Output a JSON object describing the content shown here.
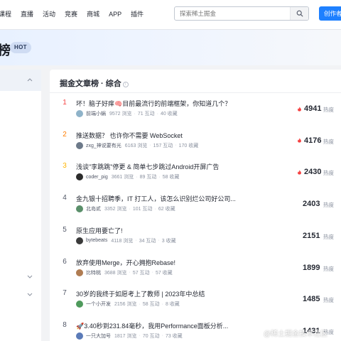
{
  "nav": {
    "items": [
      "课程",
      "直播",
      "活动",
      "竞赛",
      "商城",
      "APP",
      "插件"
    ]
  },
  "search": {
    "placeholder": "探索稀土掘金"
  },
  "creator_button": "创作者中心",
  "hero": {
    "title": "榜",
    "badge": "HOT"
  },
  "panel": {
    "title": "掘金文章榜 · 综合",
    "info_icon": "i"
  },
  "colors": {
    "accent": "#1e80ff",
    "rank1": "#f53f3f",
    "rank2": "#ff7d00",
    "rank3": "#ffb400"
  },
  "articles": [
    {
      "rank": "1",
      "title": "坏！脑子好痒🧠目前最流行的前端框架，你知道几个？",
      "author": "前端小蜗",
      "views": "9572 浏览",
      "interactions": "71 互动",
      "saves": "40 收藏",
      "score": "4941",
      "heat_label": "热度",
      "flame": true,
      "avatar_color": "#8fb3c9"
    },
    {
      "rank": "2",
      "title": "推送数据？ 也许你不需要 WebSocket",
      "author": "zxg_神说要有光",
      "views": "6163 浏览",
      "interactions": "157 互动",
      "saves": "170 收藏",
      "score": "4176",
      "heat_label": "热度",
      "flame": true,
      "avatar_color": "#6d7a8a"
    },
    {
      "rank": "3",
      "title": "浅谈\"李跳跳\"停更 & 简单七步跳过Android开屏广告",
      "author": "coder_pig",
      "views": "3661 浏览",
      "interactions": "89 互动",
      "saves": "58 收藏",
      "score": "2430",
      "heat_label": "热度",
      "flame": true,
      "avatar_color": "#2c2c2c"
    },
    {
      "rank": "4",
      "title": "金九银十招聘季，IT 打工人，该怎么识别烂公司好公司...",
      "author": "北岛贰",
      "views": "3352 浏览",
      "interactions": "101 互动",
      "saves": "62 收藏",
      "score": "2403",
      "heat_label": "热度",
      "flame": false,
      "avatar_color": "#5a8f6a"
    },
    {
      "rank": "5",
      "title": "原生应用要亡了!",
      "author": "bytebeats",
      "views": "4118 浏览",
      "interactions": "34 互动",
      "saves": "3 收藏",
      "score": "2151",
      "heat_label": "热度",
      "flame": false,
      "avatar_color": "#3a3a3a"
    },
    {
      "rank": "6",
      "title": "放弃使用Merge，开心拥抱Rebase!",
      "author": "比特桃",
      "views": "3688 浏览",
      "interactions": "57 互动",
      "saves": "57 收藏",
      "score": "1899",
      "heat_label": "热度",
      "flame": false,
      "avatar_color": "#b07c52"
    },
    {
      "rank": "7",
      "title": "30岁的我终于如愿考上了教师 | 2023年中总结",
      "author": "一个小开发",
      "views": "2156 浏览",
      "interactions": "58 互动",
      "saves": "8 收藏",
      "score": "1485",
      "heat_label": "热度",
      "flame": false,
      "avatar_color": "#4f9a5c"
    },
    {
      "rank": "8",
      "title": "🚀3.40秒到231.84毫秒，我用Performance面板分析...",
      "author": "一只大加号",
      "views": "1817 浏览",
      "interactions": "70 互动",
      "saves": "73 收藏",
      "score": "1431",
      "heat_label": "热度",
      "flame": false,
      "avatar_color": "#5b7bb8"
    }
  ],
  "watermark": "@稀土掘金技术社区"
}
